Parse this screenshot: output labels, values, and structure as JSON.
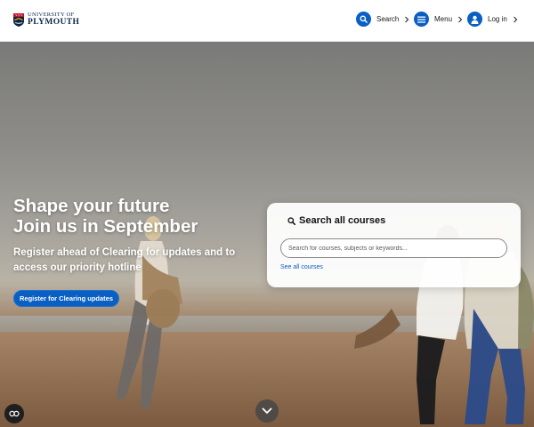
{
  "header": {
    "logo": {
      "line1": "UNIVERSITY OF",
      "line2": "PLYMOUTH"
    },
    "nav": [
      {
        "label": "Search",
        "icon": "search-icon"
      },
      {
        "label": "Menu",
        "icon": "menu-icon"
      },
      {
        "label": "Log in",
        "icon": "user-icon"
      }
    ]
  },
  "hero": {
    "title_line1": "Shape your future",
    "title_line2": "Join us in September",
    "subtitle": "Register ahead of Clearing for updates and to access our priority hotline",
    "cta_label": "Register for Clearing updates"
  },
  "search_card": {
    "title": "Search all courses",
    "placeholder": "Search for courses, subjects or keywords...",
    "value": "",
    "link": "See all courses"
  },
  "controls": {
    "scroll_icon": "chevron-down-icon",
    "captions_icon": "closed-captions-icon"
  },
  "colors": {
    "accent": "#0a5fc2",
    "header_bg": "#ffffff",
    "brand_navy": "#0b2447"
  }
}
